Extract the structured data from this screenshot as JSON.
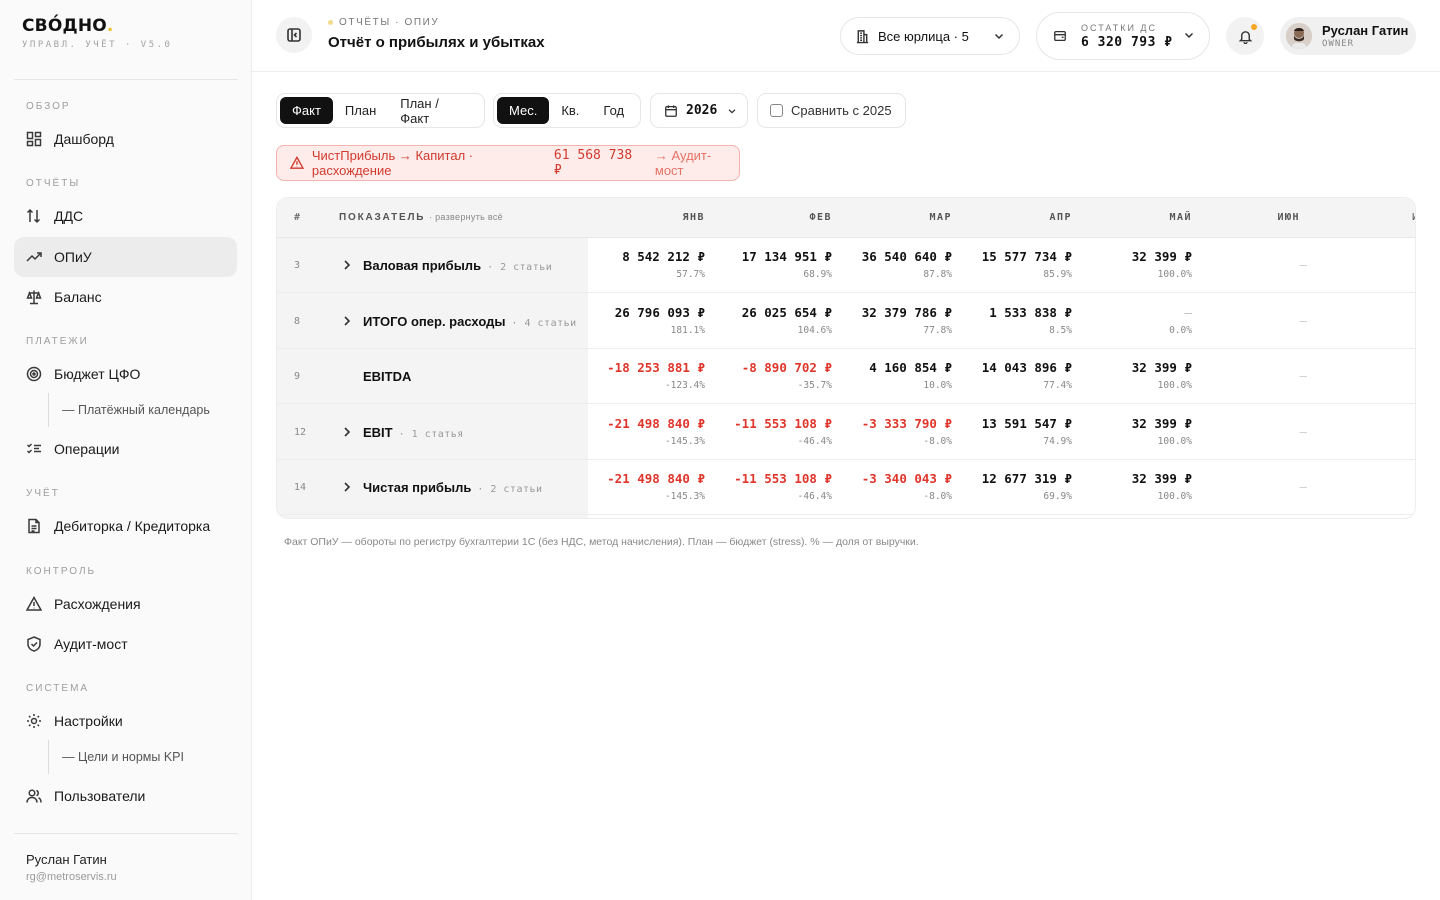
{
  "brand": {
    "name": "СВО́ДНО",
    "dot": ".",
    "subtitle": "УПРАВЛ. УЧЁТ · V5.0"
  },
  "sidebar": {
    "sections": {
      "overview": "ОБЗОР",
      "reports": "ОТЧЁТЫ",
      "payments": "ПЛАТЕЖИ",
      "accounting": "УЧЁТ",
      "control": "КОНТРОЛЬ",
      "system": "СИСТЕМА"
    },
    "items": {
      "dashboard": "Дашборд",
      "dds": "ДДС",
      "opiu": "ОПиУ",
      "balance": "Баланс",
      "budget": "Бюджет ЦФО",
      "payment_calendar": "— Платёжный календарь",
      "operations": "Операции",
      "receivables": "Дебиторка / Кредиторка",
      "discrepancies": "Расхождения",
      "audit_bridge": "Аудит-мост",
      "settings": "Настройки",
      "kpi": "— Цели и нормы KPI",
      "users": "Пользователи"
    },
    "user": {
      "name": "Руслан Гатин",
      "email": "rg@metroservis.ru"
    }
  },
  "header": {
    "breadcrumb": "ОТЧЁТЫ · ОПИУ",
    "title": "Отчёт о прибылях и убытках",
    "entities": "Все юрлица · 5",
    "balance_label": "ОСТАТКИ ДС",
    "balance_value": "6 320 793 ₽",
    "user_name": "Руслан Гатин",
    "user_role": "OWNER"
  },
  "filters": {
    "mode": [
      "Факт",
      "План",
      "План / Факт"
    ],
    "mode_active": 0,
    "period": [
      "Мес.",
      "Кв.",
      "Год"
    ],
    "period_active": 0,
    "year": "2026",
    "compare": "Сравнить с 2025"
  },
  "alert": {
    "text": "ЧистПрибыль → Капитал · расхождение ",
    "amount": "61 568 738 ₽",
    "link": "→ Аудит-мост"
  },
  "table": {
    "col_hash": "#",
    "col_indicator": "ПОКАЗАТЕЛЬ",
    "expand_all": "· развернуть всё",
    "months": [
      "ЯНВ",
      "ФЕВ",
      "МАР",
      "АПР",
      "МАЙ",
      "ИЮН",
      "И"
    ],
    "rows": [
      {
        "num": "3",
        "name": "Валовая прибыль",
        "count": "· 2 статьи",
        "expandable": true,
        "values": [
          {
            "v": "8 542 212 ₽",
            "p": "57.7%",
            "neg": false
          },
          {
            "v": "17 134 951 ₽",
            "p": "68.9%",
            "neg": false
          },
          {
            "v": "36 540 640 ₽",
            "p": "87.8%",
            "neg": false
          },
          {
            "v": "15 577 734 ₽",
            "p": "85.9%",
            "neg": false
          },
          {
            "v": "32 399 ₽",
            "p": "100.0%",
            "neg": false
          },
          {
            "v": "—",
            "p": "",
            "empty": true
          }
        ]
      },
      {
        "num": "8",
        "name": "ИТОГО опер. расходы",
        "count": "· 4 статьи",
        "expandable": true,
        "values": [
          {
            "v": "26 796 093 ₽",
            "p": "181.1%",
            "neg": false
          },
          {
            "v": "26 025 654 ₽",
            "p": "104.6%",
            "neg": false
          },
          {
            "v": "32 379 786 ₽",
            "p": "77.8%",
            "neg": false
          },
          {
            "v": "1 533 838 ₽",
            "p": "8.5%",
            "neg": false
          },
          {
            "v": "—",
            "p": "0.0%",
            "dash": true
          },
          {
            "v": "—",
            "p": "",
            "empty": true
          }
        ]
      },
      {
        "num": "9",
        "name": "EBITDA",
        "count": "",
        "expandable": false,
        "values": [
          {
            "v": "-18 253 881 ₽",
            "p": "-123.4%",
            "neg": true
          },
          {
            "v": "-8 890 702 ₽",
            "p": "-35.7%",
            "neg": true
          },
          {
            "v": "4 160 854 ₽",
            "p": "10.0%",
            "neg": false
          },
          {
            "v": "14 043 896 ₽",
            "p": "77.4%",
            "neg": false
          },
          {
            "v": "32 399 ₽",
            "p": "100.0%",
            "neg": false
          },
          {
            "v": "—",
            "p": "",
            "empty": true
          }
        ]
      },
      {
        "num": "12",
        "name": "EBIT",
        "count": "· 1 статья",
        "expandable": true,
        "values": [
          {
            "v": "-21 498 840 ₽",
            "p": "-145.3%",
            "neg": true
          },
          {
            "v": "-11 553 108 ₽",
            "p": "-46.4%",
            "neg": true
          },
          {
            "v": "-3 333 790 ₽",
            "p": "-8.0%",
            "neg": true
          },
          {
            "v": "13 591 547 ₽",
            "p": "74.9%",
            "neg": false
          },
          {
            "v": "32 399 ₽",
            "p": "100.0%",
            "neg": false
          },
          {
            "v": "—",
            "p": "",
            "empty": true
          }
        ]
      },
      {
        "num": "14",
        "name": "Чистая прибыль",
        "count": "· 2 статьи",
        "expandable": true,
        "values": [
          {
            "v": "-21 498 840 ₽",
            "p": "-145.3%",
            "neg": true
          },
          {
            "v": "-11 553 108 ₽",
            "p": "-46.4%",
            "neg": true
          },
          {
            "v": "-3 340 043 ₽",
            "p": "-8.0%",
            "neg": true
          },
          {
            "v": "12 677 319 ₽",
            "p": "69.9%",
            "neg": false
          },
          {
            "v": "32 399 ₽",
            "p": "100.0%",
            "neg": false
          },
          {
            "v": "—",
            "p": "",
            "empty": true
          }
        ]
      }
    ]
  },
  "footnote": "Факт ОПиУ — обороты по регистру бухгалтерии 1С (без НДС, метод начисления). План — бюджет (stress). % — доля от выручки.",
  "colors": {
    "accent": "#111111",
    "negative": "#e0352b",
    "alert_bg": "#fdecea",
    "alert_border": "#f4b3ad",
    "brand_dot": "#e8c22d"
  }
}
